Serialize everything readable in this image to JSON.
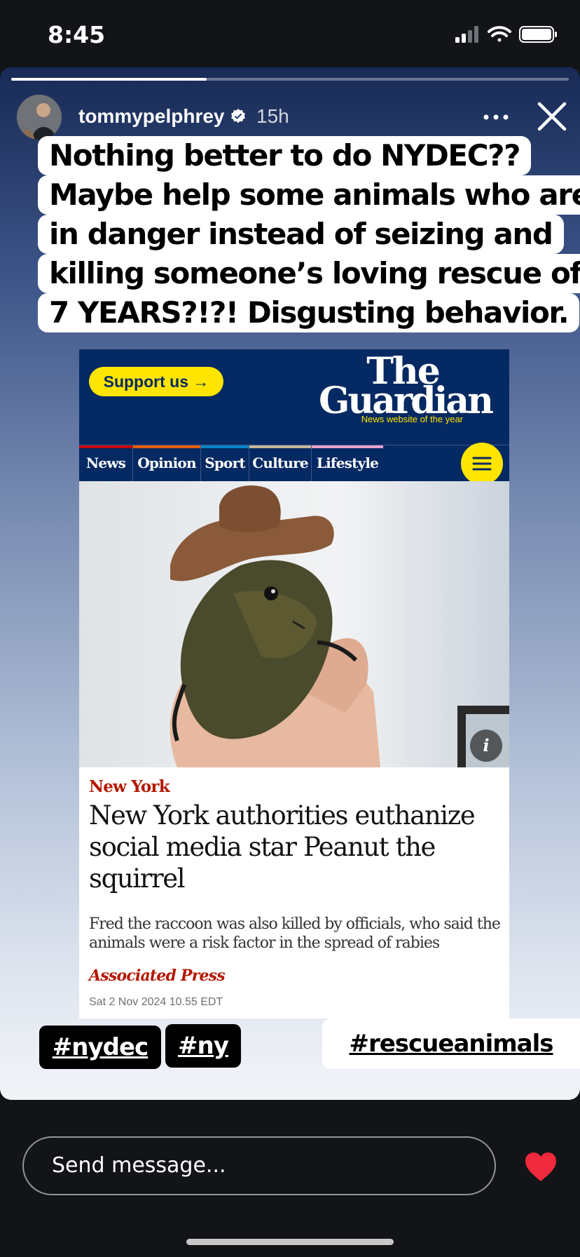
{
  "status_bar": {
    "time": "8:45"
  },
  "story": {
    "progress": 0.35,
    "username": "tommypelphrey",
    "time_ago": "15h",
    "caption_lines": [
      "Nothing better to do NYDEC??",
      "Maybe help some animals who are",
      "in danger instead of seizing and",
      "killing someone’s loving rescue of",
      "7 YEARS?!?!  Disgusting behavior."
    ],
    "hashtags": [
      "#nydec",
      "#ny",
      "#rescueanimals"
    ]
  },
  "guardian": {
    "support_label": "Support us →",
    "logo_line1": "The",
    "logo_line2": "Guardian",
    "logo_tagline": "News website of the year",
    "nav": [
      {
        "label": "News",
        "color": "#c70000"
      },
      {
        "label": "Opinion",
        "color": "#e05e00"
      },
      {
        "label": "Sport",
        "color": "#0084c6"
      },
      {
        "label": "Culture",
        "color": "#a1845c"
      },
      {
        "label": "Lifestyle",
        "color": "#bb3b80"
      }
    ],
    "article": {
      "section": "New York",
      "headline": "New York authorities euthanize social media star Peanut the squirrel",
      "standfirst": "Fred the raccoon was also killed by officials, who said the animals were a risk factor in the spread of rabies",
      "byline": "Associated Press",
      "date": "Sat 2 Nov 2024 10.55 EDT"
    }
  },
  "reply": {
    "placeholder": "Send message..."
  }
}
